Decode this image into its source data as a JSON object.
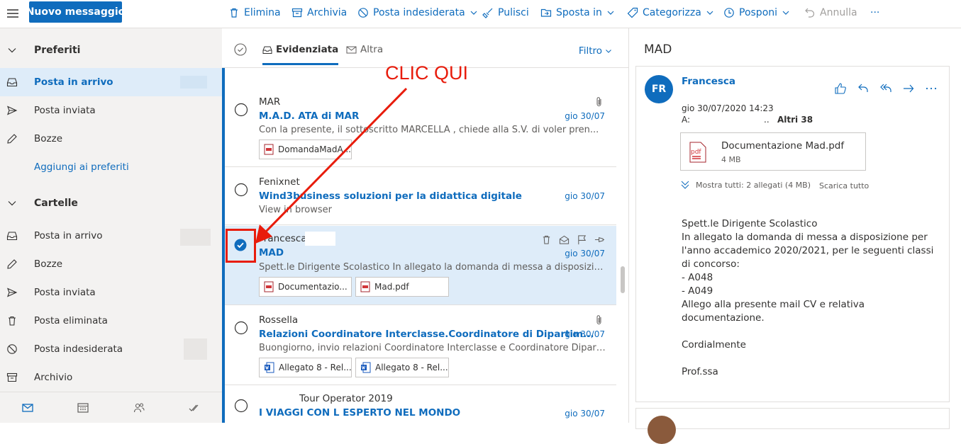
{
  "toolbar": {
    "new_message": "Nuovo messaggio",
    "delete": "Elimina",
    "archive": "Archivia",
    "junk": "Posta indesiderata",
    "sweep": "Pulisci",
    "move": "Sposta in",
    "categorize": "Categorizza",
    "snooze": "Posponi",
    "undo": "Annulla",
    "more": "···"
  },
  "sidebar": {
    "favorites_header": "Preferiti",
    "favorites": [
      {
        "label": "Posta in arrivo",
        "icon": "inbox-icon",
        "selected": true
      },
      {
        "label": "Posta inviata",
        "icon": "send-icon"
      },
      {
        "label": "Bozze",
        "icon": "pencil-icon"
      }
    ],
    "add_favorite": "Aggiungi ai preferiti",
    "folders_header": "Cartelle",
    "folders": [
      {
        "label": "Posta in arrivo",
        "icon": "inbox-icon"
      },
      {
        "label": "Bozze",
        "icon": "pencil-icon"
      },
      {
        "label": "Posta inviata",
        "icon": "send-icon"
      },
      {
        "label": "Posta eliminata",
        "icon": "trash-icon"
      },
      {
        "label": "Posta indesiderata",
        "icon": "block-icon"
      },
      {
        "label": "Archivio",
        "icon": "archive-icon"
      }
    ]
  },
  "list": {
    "focused_tab": "Evidenziata",
    "other_tab": "Altra",
    "filter": "Filtro",
    "messages": [
      {
        "sender": "MAR",
        "subject": "M.A.D. ATA di MAR",
        "date": "gio 30/07",
        "preview": "Con la presente, il sottoscritto MARCELLA          , chiede alla S.V. di voler pren...",
        "attachments": [
          "DomandaMadA..."
        ]
      },
      {
        "sender": "Fenixnet",
        "subject": "Wind3business soluzioni per la didattica digitale",
        "date": "gio 30/07",
        "preview": "View in browser",
        "attachments": []
      },
      {
        "sender": "Francesca",
        "subject": "MAD",
        "date": "gio 30/07",
        "preview": "Spett.le Dirigente Scolastico In allegato la domanda di messa a disposizione ...",
        "attachments": [
          "Documentazio...",
          "Mad.pdf"
        ],
        "selected": true
      },
      {
        "sender": "Rossella",
        "subject": "Relazioni Coordinatore Interclasse.Coordinatore di Dipartim...",
        "date": "gio 30/07",
        "preview": "Buongiorno, invio relazioni Coordinatore Interclasse e Coordinatore Dipartim...",
        "attachments": [
          "Allegato 8 - Rel...",
          "Allegato 8 - Rel..."
        ]
      },
      {
        "sender": "Tour Operator 2019",
        "subject": "I VIAGGI CON L ESPERTO NEL MONDO",
        "date": "gio 30/07",
        "preview": "",
        "attachments": []
      }
    ]
  },
  "annotation": "CLIC QUI",
  "reading": {
    "title": "MAD",
    "avatar": "FR",
    "from": "Francesca",
    "date": "gio 30/07/2020 14:23",
    "to_label": "A:",
    "others": "..",
    "others_count": "Altri 38",
    "attachment_name": "Documentazione Mad.pdf",
    "attachment_size": "4 MB",
    "show_all": "Mostra tutti: 2 allegati (4 MB)",
    "download_all": "Scarica tutto",
    "body": "Spett.le Dirigente Scolastico\nIn allegato la domanda di messa a disposizione per l'anno accademico 2020/2021, per le seguenti classi di concorso:\n- A048\n- A049\nAllego alla presente mail CV e relativa documentazione.\n\nCordialmente\n\nProf.ssa"
  },
  "colors": {
    "accent": "#0f6cbd",
    "annotation": "#e81c0c",
    "selected_bg": "#deecf9"
  }
}
